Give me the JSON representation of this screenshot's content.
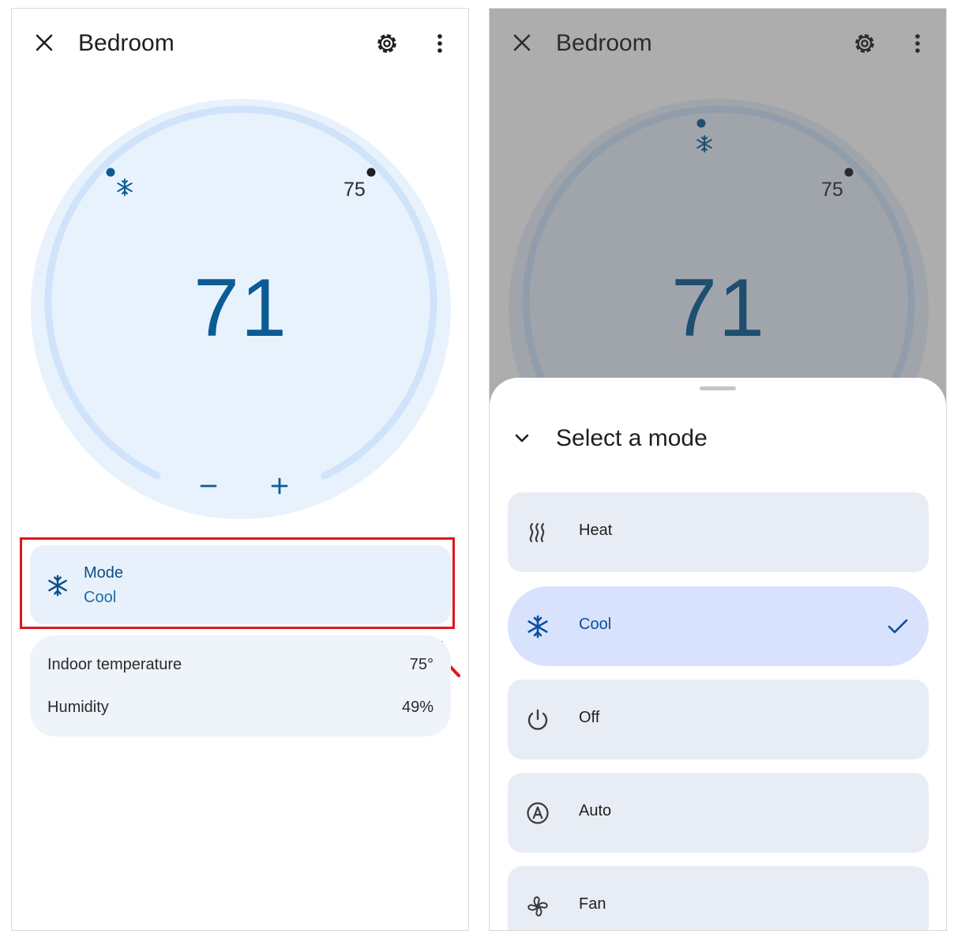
{
  "left": {
    "header": {
      "title": "Bedroom"
    },
    "dial": {
      "current_temp": "71",
      "setpoint": "75"
    },
    "mode": {
      "label": "Mode",
      "value": "Cool"
    },
    "info": [
      {
        "label": "Indoor temperature",
        "value": "75°"
      },
      {
        "label": "Humidity",
        "value": "49%"
      }
    ]
  },
  "right": {
    "header": {
      "title": "Bedroom"
    },
    "dial": {
      "current_temp": "71",
      "setpoint": "75"
    },
    "sheet": {
      "title": "Select a mode",
      "options": [
        {
          "label": "Heat",
          "icon": "heat-icon",
          "selected": false
        },
        {
          "label": "Cool",
          "icon": "snowflake-icon",
          "selected": true
        },
        {
          "label": "Off",
          "icon": "power-icon",
          "selected": false
        },
        {
          "label": "Auto",
          "icon": "auto-icon",
          "selected": false
        },
        {
          "label": "Fan",
          "icon": "fan-icon",
          "selected": false
        }
      ]
    }
  },
  "colors": {
    "accent": "#0b5c94",
    "dial_bg": "#e8f2fd",
    "dial_ring": "#cfe3fb",
    "highlight": "#e0161c",
    "selected_option": "#d8e2fc"
  }
}
